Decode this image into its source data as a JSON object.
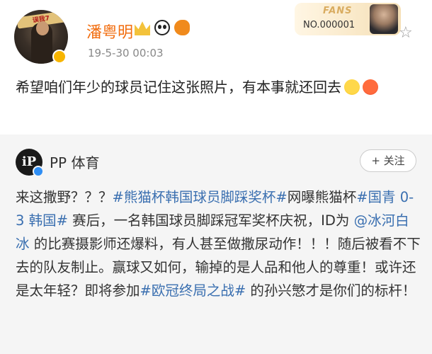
{
  "post": {
    "author": "潘粤明",
    "avatar_banner_text": "误我7",
    "timestamp": "19-5-30 00:03",
    "fans_card": {
      "label": "FANS",
      "number": "NO.000001"
    },
    "text": "希望咱们年少的球员记住这张照片，有本事就还回去",
    "emojis": [
      "tears-of-joy-icon",
      "angry-face-icon"
    ],
    "badges": [
      "crown-icon",
      "panda-icon",
      "fish-icon"
    ]
  },
  "repost": {
    "source": "PP 体育",
    "source_avatar_text": "iP",
    "follow_label": "+ 关注",
    "segments": [
      {
        "t": "来这撒野？？？",
        "link": false
      },
      {
        "t": "#熊猫杯韩国球员脚踩奖杯#",
        "link": true
      },
      {
        "t": "网曝熊猫杯",
        "link": false
      },
      {
        "t": "#国青 0-3 韩国#",
        "link": true
      },
      {
        "t": " 赛后，一名韩国球员脚踩冠军奖杯庆祝，ID为 ",
        "link": false
      },
      {
        "t": "@冰河白冰",
        "link": true
      },
      {
        "t": " 的比赛摄影师还爆料，有人甚至做撒尿动作！！！随后被看不下去的队友制止。赢球又如何，输掉的是人品和他人的尊重！或许还是太年轻？即将参加",
        "link": false
      },
      {
        "t": "#欧冠终局之战#",
        "link": true
      },
      {
        "t": " 的孙兴慜才是你们的标杆！",
        "link": false
      }
    ]
  },
  "colors": {
    "username": "#f26d0f",
    "link": "#3a6fb0",
    "repost_bg": "#f5f5f5"
  }
}
